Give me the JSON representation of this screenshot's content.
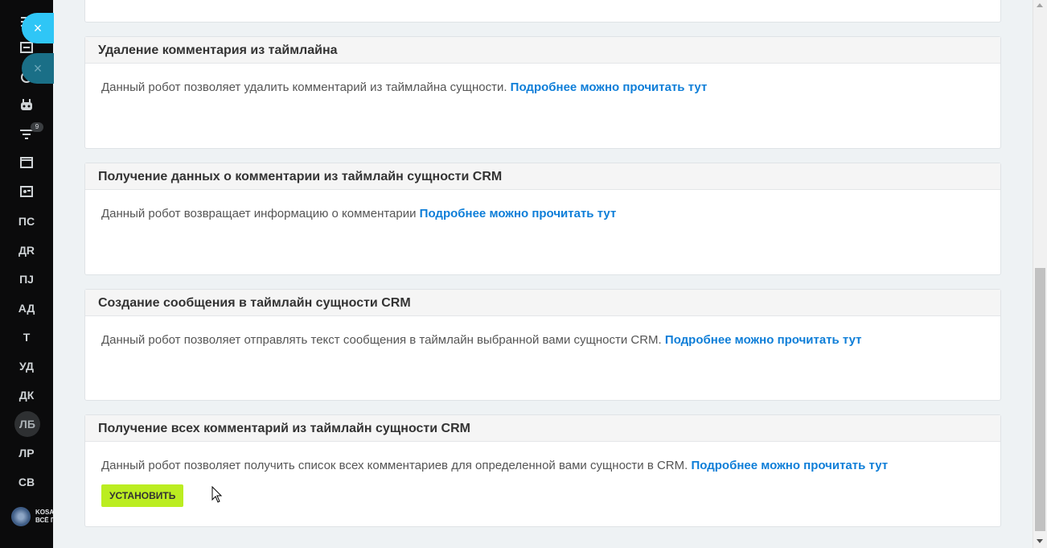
{
  "sidebar": {
    "items": [
      {
        "type": "icon",
        "icon": "menu-icon"
      },
      {
        "type": "icon",
        "icon": "calendar-icon"
      },
      {
        "type": "icon",
        "icon": "clock-icon"
      },
      {
        "type": "icon",
        "icon": "robot-icon"
      },
      {
        "type": "icon",
        "icon": "filter-icon",
        "badge": "9"
      },
      {
        "type": "icon",
        "icon": "window-icon"
      },
      {
        "type": "icon",
        "icon": "contact-card-icon"
      },
      {
        "type": "text",
        "label": "ПС"
      },
      {
        "type": "text",
        "label": "ДR"
      },
      {
        "type": "text",
        "label": "ПЈ"
      },
      {
        "type": "text",
        "label": "АД"
      },
      {
        "type": "text",
        "label": "Т"
      },
      {
        "type": "text",
        "label": "УД"
      },
      {
        "type": "text",
        "label": "ДК"
      },
      {
        "type": "avatar",
        "label": "ЛБ"
      },
      {
        "type": "text",
        "label": "ЛР"
      },
      {
        "type": "text",
        "label": "СВ"
      }
    ],
    "brand_text": "KOSA\nВСЁ П"
  },
  "close_buttons": [
    "×",
    "×"
  ],
  "cards": [
    {
      "title": "Удаление комментария из таймлайна",
      "description": "Данный робот позволяет удалить комментарий из таймлайна сущности. ",
      "link": "Подробнее можно прочитать тут"
    },
    {
      "title": "Получение данных о комментарии из таймлайн сущности CRM",
      "description": "Данный робот возвращает информацию о комментарии ",
      "link": "Подробнее можно прочитать тут"
    },
    {
      "title": "Создание сообщения в таймлайн сущности CRM",
      "description": "Данный робот позволяет отправлять текст сообщения в таймлайн выбранной вами сущности CRM. ",
      "link": "Подробнее можно прочитать тут"
    },
    {
      "title": "Получение всех комментарий из таймлайн сущности CRM",
      "description": "Данный робот позволяет получить список всех комментариев для определенной вами сущности в CRM. ",
      "link": "Подробнее можно прочитать тут",
      "button": "УСТАНОВИТЬ"
    }
  ],
  "colors": {
    "sidebar_bg": "#0b0b0c",
    "accent_close": "#2fc6f6",
    "link": "#0e7ed8",
    "install_button": "#bbed21"
  }
}
